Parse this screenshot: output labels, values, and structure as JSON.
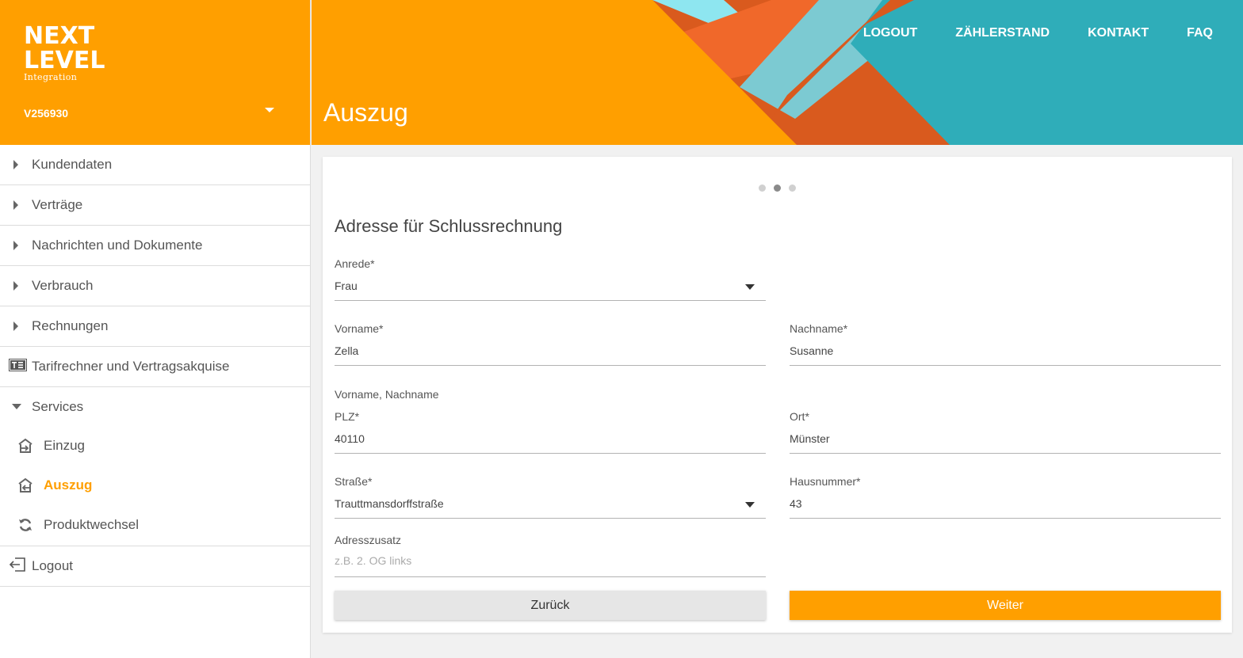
{
  "brand": {
    "line1": "NEXT",
    "line2": "LEVEL",
    "line3": "Integration",
    "accent": "#ff9f00"
  },
  "account": {
    "id": "V256930"
  },
  "header": {
    "title": "Auszug"
  },
  "topnav": {
    "logout": "LOGOUT",
    "meter": "ZÄHLERSTAND",
    "contact": "KONTAKT",
    "faq": "FAQ"
  },
  "sidebar": {
    "items": [
      {
        "label": "Kundendaten",
        "icon": "caret-right-icon"
      },
      {
        "label": "Verträge",
        "icon": "caret-right-icon"
      },
      {
        "label": "Nachrichten und Dokumente",
        "icon": "caret-right-icon"
      },
      {
        "label": "Verbrauch",
        "icon": "caret-right-icon"
      },
      {
        "label": "Rechnungen",
        "icon": "caret-right-icon"
      },
      {
        "label": "Tarifrechner und Vertragsakquise",
        "icon": "calculator-icon"
      }
    ],
    "services": {
      "label": "Services",
      "children": [
        {
          "label": "Einzug",
          "icon": "move-in-icon"
        },
        {
          "label": "Auszug",
          "icon": "move-out-icon",
          "active": true
        },
        {
          "label": "Produktwechsel",
          "icon": "refresh-icon"
        }
      ]
    },
    "logout": {
      "label": "Logout",
      "icon": "logout-icon"
    }
  },
  "stepper": {
    "steps": 3,
    "current": 2
  },
  "form": {
    "title": "Adresse für Schlussrechnung",
    "salutation": {
      "label": "Anrede*",
      "value": "Frau"
    },
    "firstname": {
      "label": "Vorname*",
      "value": "Zella"
    },
    "lastname": {
      "label": "Nachname*",
      "value": "Susanne"
    },
    "hint": "Vorname, Nachname",
    "zip": {
      "label": "PLZ*",
      "value": "40110"
    },
    "city": {
      "label": "Ort*",
      "value": "Münster"
    },
    "street": {
      "label": "Straße*",
      "value": "Trauttmansdorffstraße"
    },
    "housenumber": {
      "label": "Hausnummer*",
      "value": "43"
    },
    "addition": {
      "label": "Adresszusatz",
      "placeholder": "z.B. 2. OG links"
    },
    "back_label": "Zurück",
    "next_label": "Weiter"
  }
}
